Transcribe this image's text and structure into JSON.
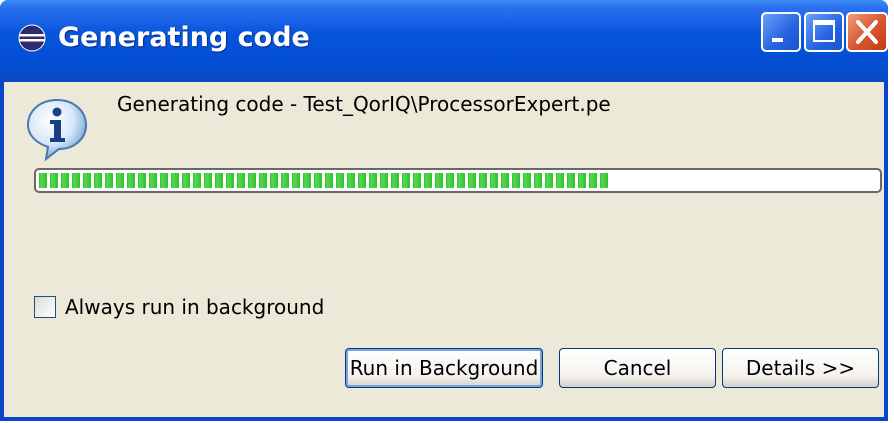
{
  "window": {
    "title": "Generating code",
    "icons": {
      "app": "eclipse-icon",
      "minimize": "minimize-icon",
      "maximize": "maximize-icon",
      "close": "close-icon"
    },
    "colors": {
      "titlebar": "#0855dd",
      "client": "#ece9d8",
      "close_button": "#d8542e"
    }
  },
  "dialog": {
    "message": "Generating code - Test_QorIQ\\ProcessorExpert.pe",
    "message_icon": "info-icon",
    "progress": {
      "fraction": 0.68,
      "color": "#2ec42a"
    },
    "always_background": {
      "label": "Always run in background",
      "checked": false
    },
    "buttons": {
      "run_in_background": "Run in Background",
      "cancel": "Cancel",
      "details": "Details >>"
    }
  }
}
